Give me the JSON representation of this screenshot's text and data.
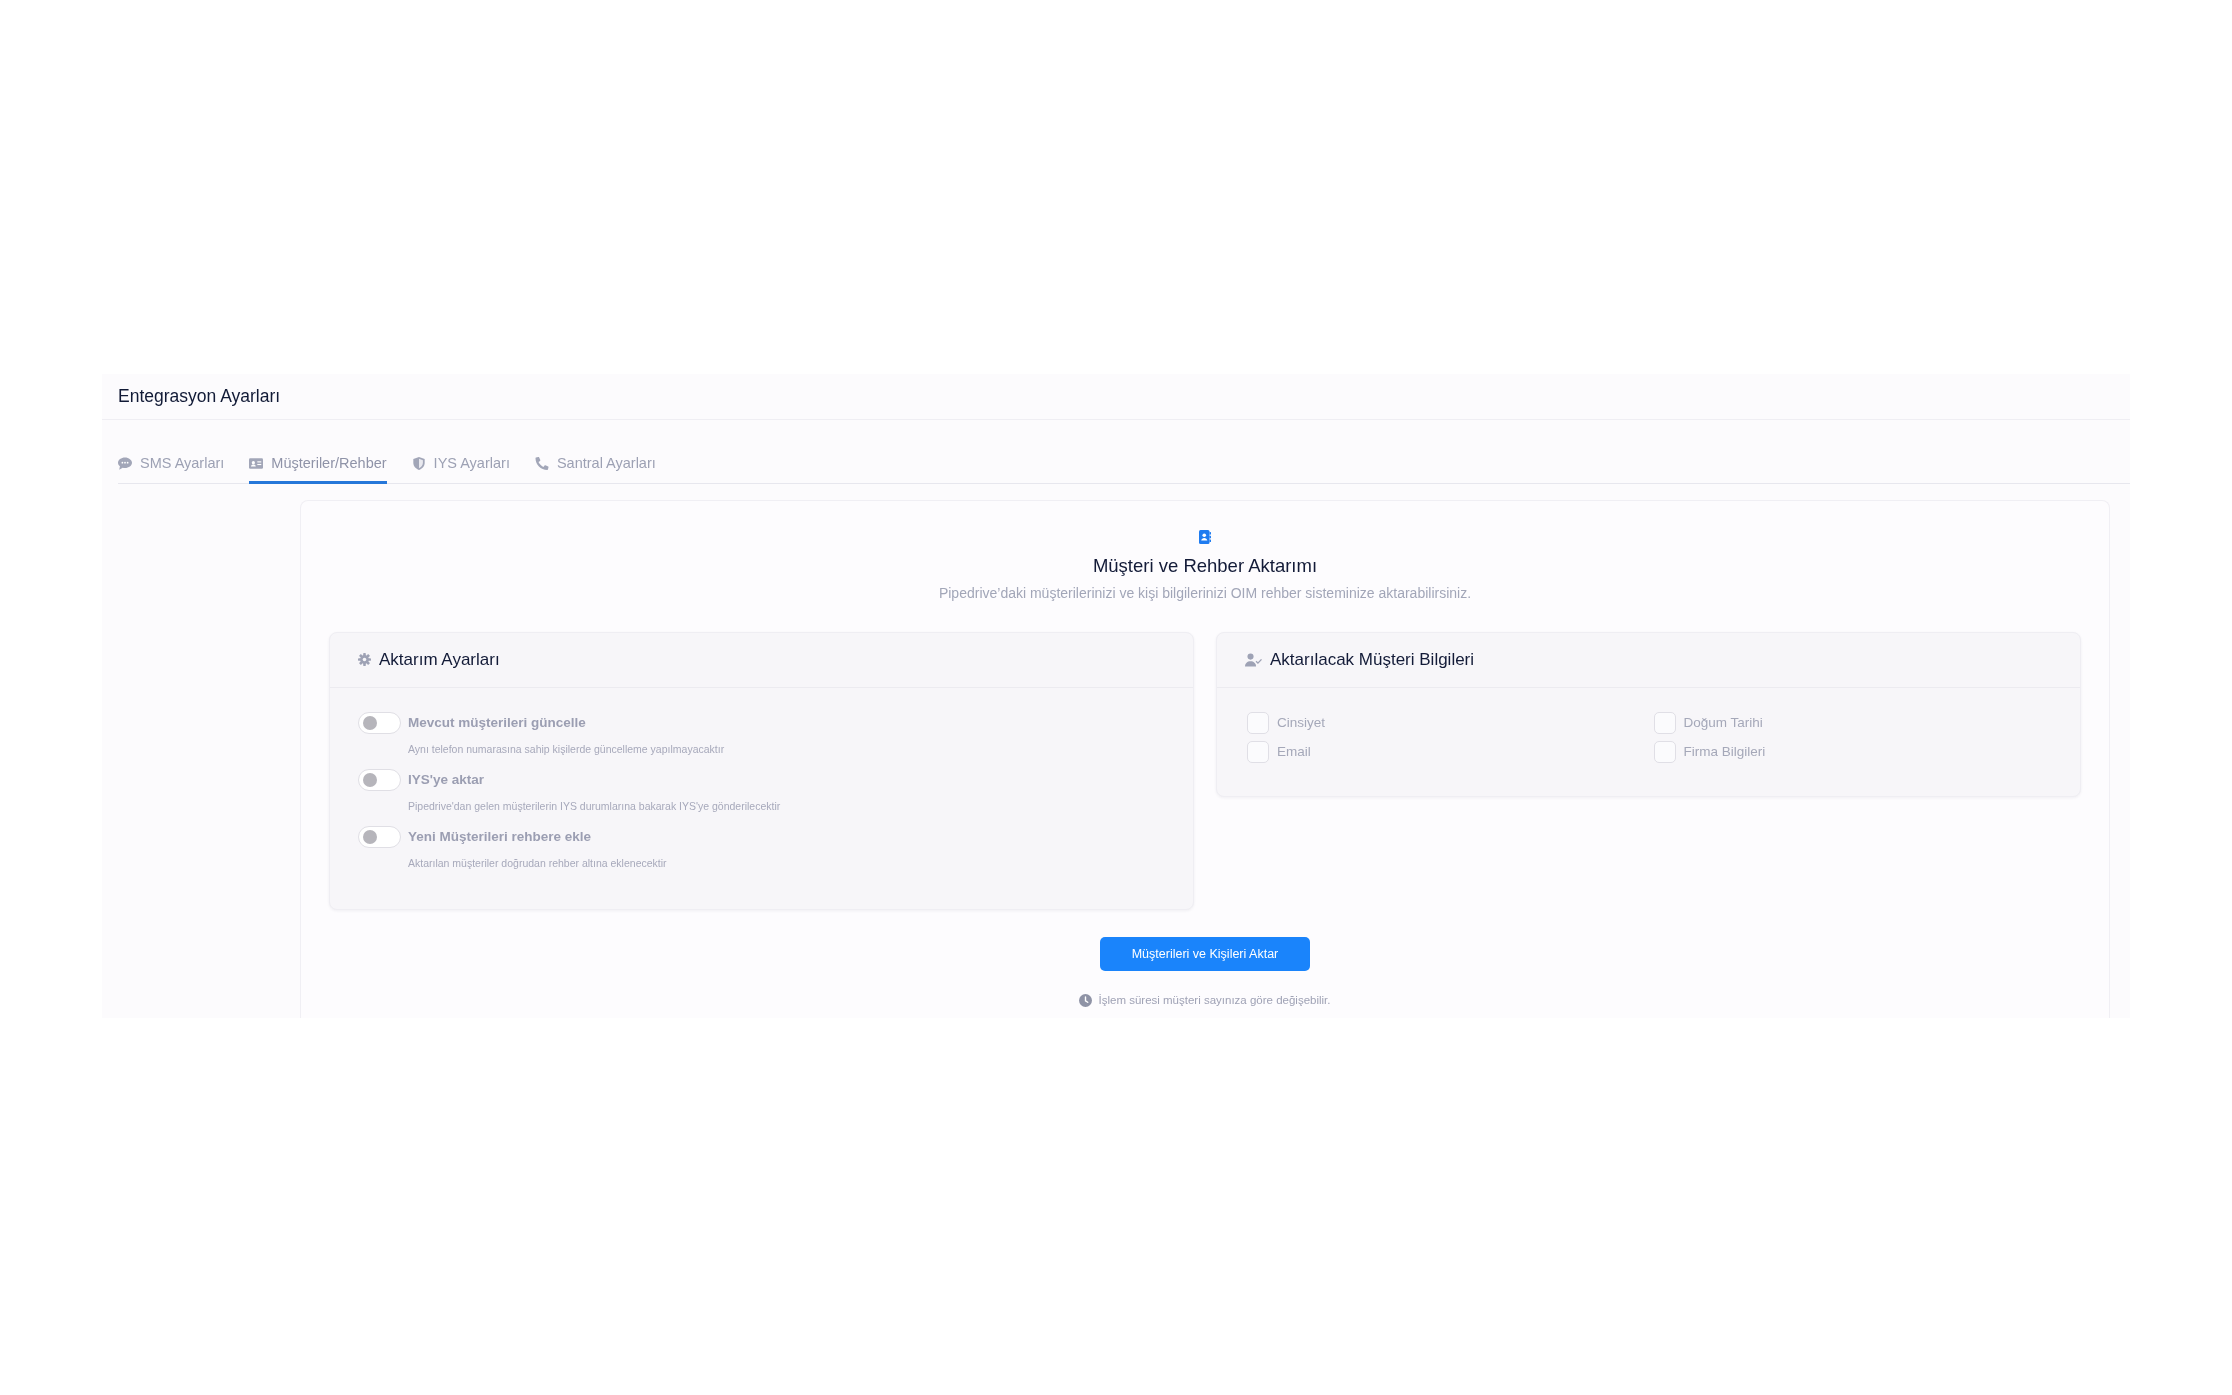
{
  "page": {
    "title": "Entegrasyon Ayarları"
  },
  "tabs": [
    {
      "label": "SMS Ayarları",
      "selected": false
    },
    {
      "label": "Müşteriler/Rehber",
      "selected": true
    },
    {
      "label": "IYS Ayarları",
      "selected": false
    },
    {
      "label": "Santral Ayarları",
      "selected": false
    }
  ],
  "section": {
    "title": "Müşteri ve Rehber Aktarımı",
    "subtitle": "Pipedrive’daki müşterilerinizi ve kişi bilgilerinizi OIM rehber sisteminize aktarabilirsiniz."
  },
  "settings_card": {
    "title": "Aktarım Ayarları",
    "options": [
      {
        "label": "Mevcut müşterileri güncelle",
        "description": "Aynı telefon numarasına sahip kişilerde güncelleme yapılmayacaktır",
        "on": false
      },
      {
        "label": "IYS'ye aktar",
        "description": "Pipedrive'dan gelen müşterilerin IYS durumlarına bakarak IYS'ye gönderilecektir",
        "on": false
      },
      {
        "label": "Yeni Müşterileri rehbere ekle",
        "description": "Aktarılan müşteriler doğrudan rehber altına eklenecektir",
        "on": false
      }
    ]
  },
  "fields_card": {
    "title": "Aktarılacak Müşteri Bilgileri",
    "fields": [
      {
        "label": "Cinsiyet",
        "checked": false
      },
      {
        "label": "Doğum Tarihi",
        "checked": false
      },
      {
        "label": "Email",
        "checked": false
      },
      {
        "label": "Firma Bilgileri",
        "checked": false
      }
    ]
  },
  "action": {
    "button": "Müşterileri ve Kişileri Aktar",
    "note": "İşlem süresi müşteri sayınıza göre değişebilir."
  }
}
